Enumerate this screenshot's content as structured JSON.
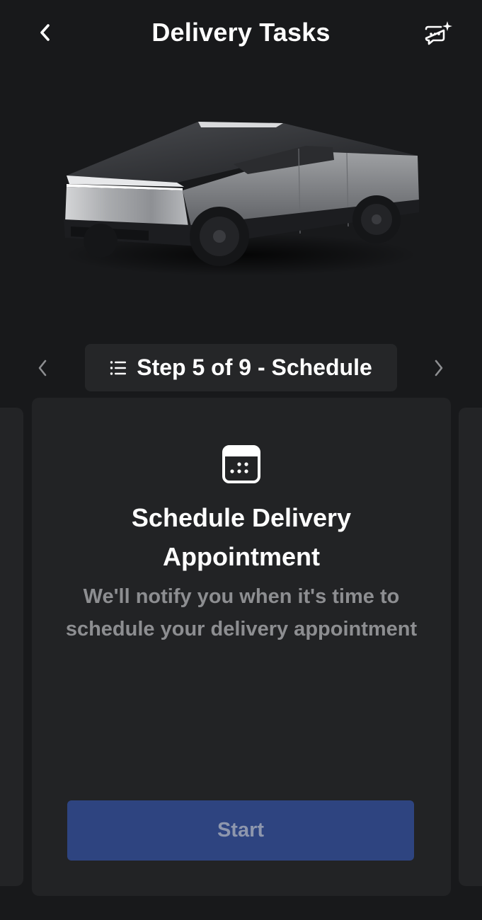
{
  "header": {
    "title": "Delivery Tasks",
    "back_icon": "chevron-left-icon",
    "chat_icon": "chat-sparkle-icon"
  },
  "hero": {
    "image": "cybertruck-image"
  },
  "step_nav": {
    "label": "Step 5 of 9 - Schedule",
    "list_icon": "list-icon",
    "prev_icon": "chevron-left-icon",
    "next_icon": "chevron-right-icon"
  },
  "card": {
    "icon": "calendar-icon",
    "title": "Schedule Delivery Appointment",
    "description": "We'll notify you when it's time to schedule your delivery appointment",
    "button_label": "Start"
  },
  "colors": {
    "background": "#18191b",
    "card": "#222325",
    "button": "#2e4480",
    "button_text": "#8e97ad",
    "muted_text": "#8d8e91"
  }
}
